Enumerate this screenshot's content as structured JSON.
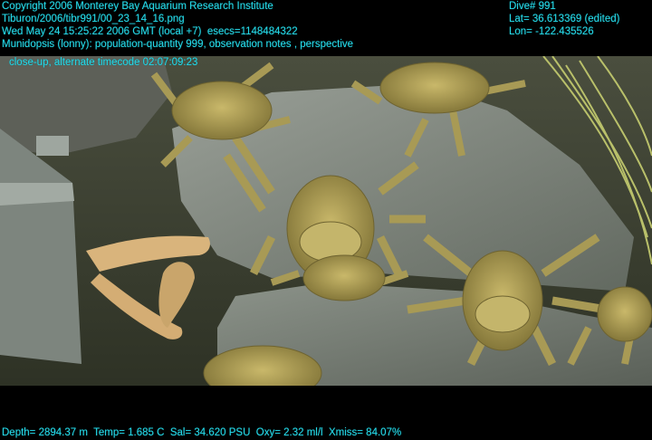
{
  "header": {
    "copyright": "Copyright 2006 Monterey Bay Aquarium Research Institute",
    "file_path": "Tiburon/2006/tibr991/00_23_14_16.png",
    "datetime": "Wed May 24 15:25:22 2006 GMT (local +7)  esecs=1148484322",
    "observation_line1": "Munidopsis (lonny): population-quantity 999, observation notes , perspective",
    "observation_line2": "close-up, alternate timecode 02:07:09:23",
    "dive": "Dive# 991",
    "latitude": "Lat= 36.613369 (edited)",
    "longitude": "Lon= -122.435526"
  },
  "footer": {
    "telemetry": "Depth= 2894.37 m  Temp= 1.685 C  Sal= 34.620 PSU  Oxy= 2.32 ml/l  Xmiss= 84.07%"
  },
  "colors": {
    "overlay_text": "#27d9e8",
    "background": "#000000",
    "crab": "#b0a152",
    "rock": "#8a9088",
    "sediment": "#3e4131"
  },
  "scene": {
    "subject": "squat lobsters on rocks"
  }
}
